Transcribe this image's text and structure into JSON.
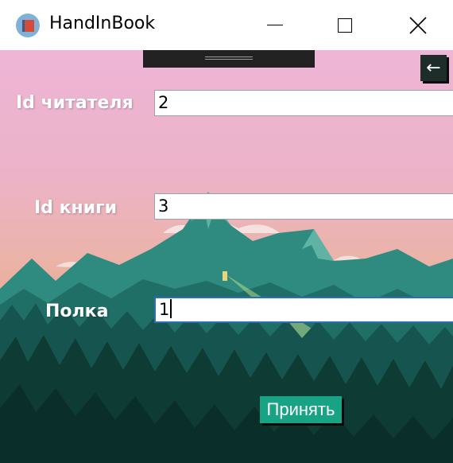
{
  "window": {
    "title": "HandInBook",
    "app_icon": "book-app-icon",
    "controls": [
      "minimize-icon",
      "maximize-icon",
      "close-icon"
    ]
  },
  "toolbar": {
    "back_label": "←"
  },
  "form": {
    "reader_id": {
      "label": "Id читателя",
      "value": "2"
    },
    "book_id": {
      "label": "Id книги",
      "value": "3"
    },
    "shelf": {
      "label": "Полка",
      "value": "1"
    },
    "submit_label": "Принять"
  },
  "colors": {
    "accent_button": "#18a385",
    "sky_top": "#eeb5d6",
    "forest_dark": "#0f3b35"
  }
}
